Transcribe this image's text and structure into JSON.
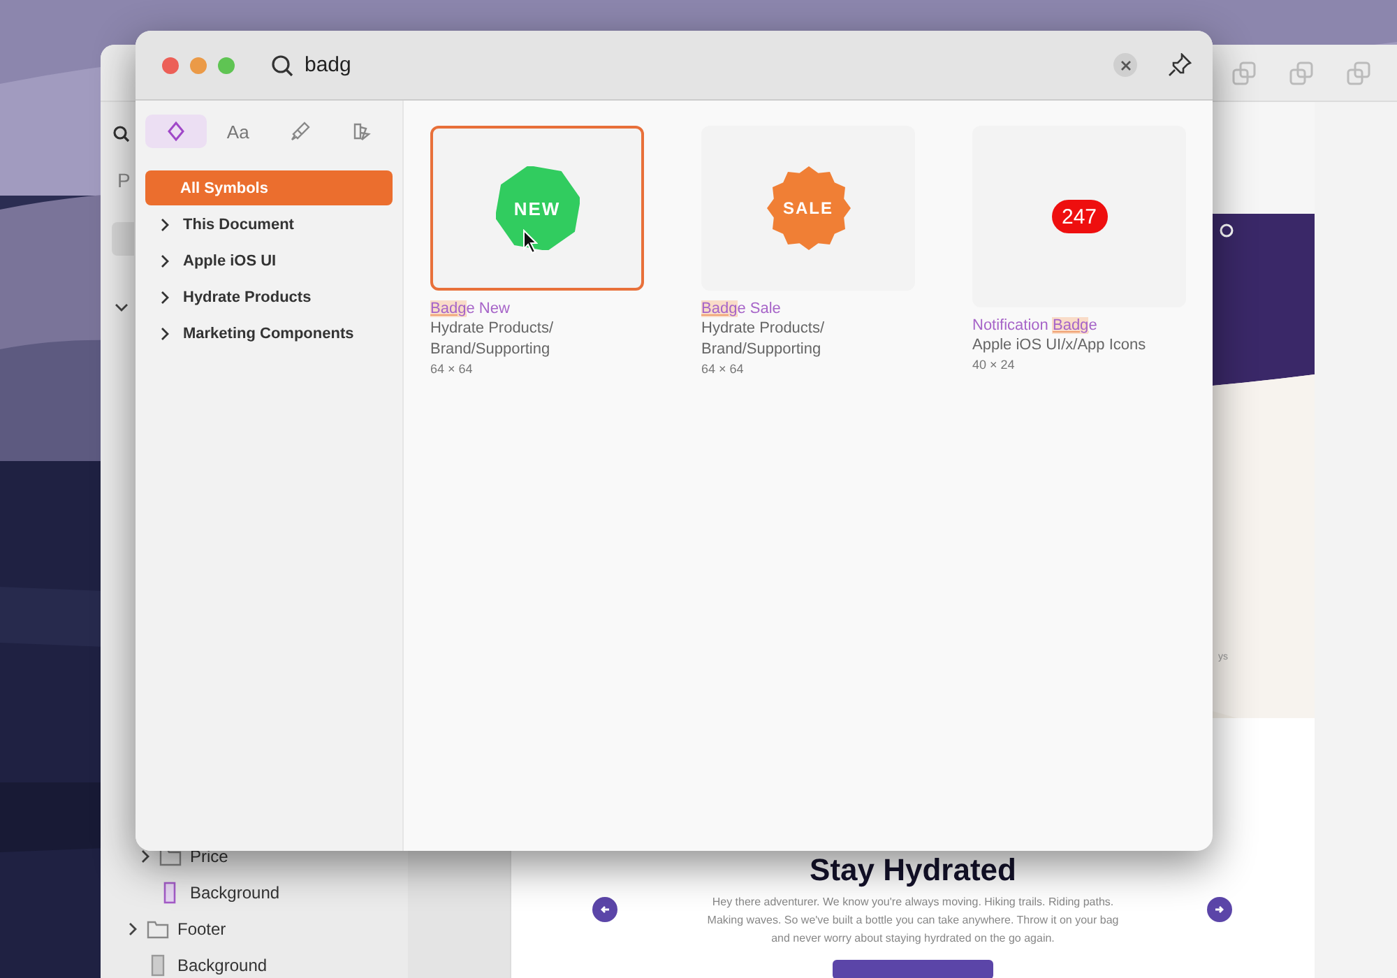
{
  "background_app": {
    "panel_label": "P",
    "layers": [
      {
        "children": [
          {
            "name": "Price",
            "kind": "folder",
            "expandable": true
          },
          {
            "name": "Background",
            "kind": "symbol",
            "expandable": false
          }
        ]
      },
      {
        "name": "Footer",
        "kind": "folder",
        "expandable": true
      },
      {
        "name": "Background",
        "kind": "rectangle",
        "expandable": false
      }
    ],
    "canvas": {
      "fragment": "ys",
      "heading": "Stay Hydrated",
      "paragraph": "Hey there adventurer. We know you're always moving. Hiking trails. Riding paths. Making waves. So we've built a bottle you can take anywhere. Throw it on your bag and never worry about staying hyrdrated on the go again."
    }
  },
  "symbol_dialog": {
    "search": {
      "value": "badg"
    },
    "tabs": [
      {
        "kind": "symbols",
        "selected": true
      },
      {
        "kind": "text",
        "label": "Aa",
        "selected": false
      },
      {
        "kind": "brush",
        "selected": false
      },
      {
        "kind": "swatch",
        "selected": false
      }
    ],
    "sources": [
      {
        "label": "All Symbols",
        "selected": true,
        "expandable": false
      },
      {
        "label": "This Document",
        "selected": false,
        "expandable": true
      },
      {
        "label": "Apple iOS UI",
        "selected": false,
        "expandable": true
      },
      {
        "label": "Hydrate Products",
        "selected": false,
        "expandable": true
      },
      {
        "label": "Marketing Components",
        "selected": false,
        "expandable": true
      }
    ],
    "results": [
      {
        "kind": "octagon",
        "preview_text": "NEW",
        "selected": true,
        "title_parts": [
          {
            "text": "Badg",
            "highlighted": true
          },
          {
            "text": "e New",
            "highlighted": false
          }
        ],
        "path_lines": [
          "Hydrate Products/",
          "Brand/Supporting"
        ],
        "size": "64 × 64"
      },
      {
        "kind": "starburst",
        "preview_text": "SALE",
        "selected": false,
        "title_parts": [
          {
            "text": "Badg",
            "highlighted": true
          },
          {
            "text": "e Sale",
            "highlighted": false
          }
        ],
        "path_lines": [
          "Hydrate Products/",
          "Brand/Supporting"
        ],
        "size": "64 × 64"
      },
      {
        "kind": "pill",
        "preview_text": "247",
        "selected": false,
        "title_parts": [
          {
            "text": "Notification ",
            "highlighted": false
          },
          {
            "text": "Badg",
            "highlighted": true
          },
          {
            "text": "e",
            "highlighted": false
          }
        ],
        "path_lines": [
          "Apple iOS UI/x/App Icons"
        ],
        "size": "40 × 24"
      }
    ]
  }
}
